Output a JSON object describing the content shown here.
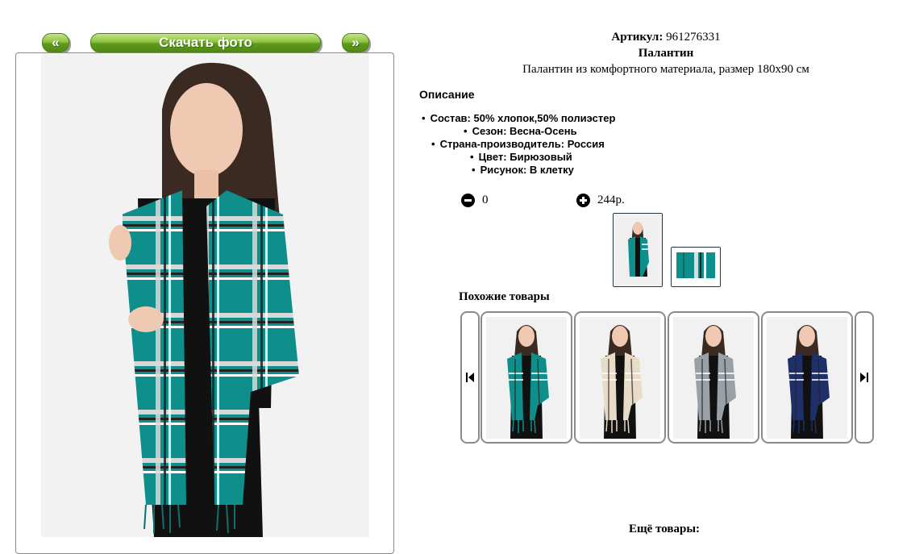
{
  "gallery": {
    "prev_label": "«",
    "download_label": "Скачать фото",
    "next_label": "»"
  },
  "product": {
    "article_label": "Артикул:",
    "article_value": "961276331",
    "name": "Палантин",
    "subtitle": "Палантин из комфортного материала, размер 180x90 см",
    "description_heading": "Описание",
    "specs": [
      "Состав: 50% хлопок,50% полиэстер",
      "Сезон: Весна-Осень",
      "Страна-производитель: Россия",
      "Цвет: Бирюзовый",
      "Рисунок: В клетку"
    ]
  },
  "cart": {
    "quantity": "0",
    "price": "244р."
  },
  "colors": {
    "teal": "#0e8f8c",
    "beige": "#e8dcc6",
    "grey": "#9aa0a8",
    "navy": "#1f2f6a"
  },
  "similar": {
    "heading": "Похожие товары",
    "items": [
      {
        "color": "teal"
      },
      {
        "color": "beige"
      },
      {
        "color": "grey"
      },
      {
        "color": "navy"
      }
    ]
  },
  "more": {
    "heading": "Ещё товары:"
  }
}
